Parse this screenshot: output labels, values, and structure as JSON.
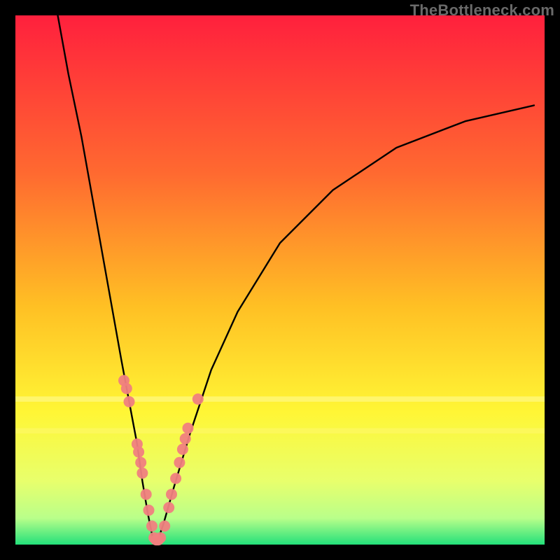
{
  "watermark": "TheBottleneck.com",
  "frame": {
    "outer_border_color": "#000000",
    "outer_border_px": 22,
    "inner_width": 756,
    "inner_height": 756
  },
  "gradient": {
    "stops": [
      {
        "offset": 0.0,
        "color": "#ff203d"
      },
      {
        "offset": 0.3,
        "color": "#ff6a30"
      },
      {
        "offset": 0.55,
        "color": "#ffc024"
      },
      {
        "offset": 0.75,
        "color": "#fff635"
      },
      {
        "offset": 0.88,
        "color": "#e8ff6c"
      },
      {
        "offset": 0.95,
        "color": "#b9ff8a"
      },
      {
        "offset": 1.0,
        "color": "#23e07a"
      }
    ],
    "notch_bands": [
      {
        "y": 0.72,
        "h": 0.01,
        "color": "#fffb9a"
      },
      {
        "y": 0.78,
        "h": 0.01,
        "color": "#fff86d"
      }
    ]
  },
  "chart_data": {
    "type": "line",
    "title": "",
    "xlabel": "",
    "ylabel": "",
    "xlim": [
      0,
      100
    ],
    "ylim": [
      0,
      100
    ],
    "series": [
      {
        "name": "bottleneck-curve",
        "color": "#000000",
        "x": [
          8,
          10,
          12.5,
          15,
          17.5,
          20,
          21.5,
          23,
          24,
          25,
          26,
          27,
          28,
          30,
          33,
          37,
          42,
          50,
          60,
          72,
          85,
          98
        ],
        "y": [
          100,
          89,
          77,
          63,
          49,
          35,
          27,
          19,
          12,
          6,
          1,
          1,
          4,
          11,
          21,
          33,
          44,
          57,
          67,
          75,
          80,
          83
        ]
      }
    ],
    "points": {
      "name": "sample-markers",
      "color": "#f08080",
      "radius": 8,
      "xy": [
        [
          20.5,
          31
        ],
        [
          21.0,
          29.5
        ],
        [
          21.5,
          27
        ],
        [
          23.0,
          19
        ],
        [
          23.3,
          17.5
        ],
        [
          23.7,
          15.5
        ],
        [
          24.0,
          13.5
        ],
        [
          24.7,
          9.5
        ],
        [
          25.2,
          6.5
        ],
        [
          25.8,
          3.5
        ],
        [
          26.2,
          1.3
        ],
        [
          26.6,
          0.9
        ],
        [
          27.0,
          0.9
        ],
        [
          27.4,
          1.3
        ],
        [
          28.2,
          3.5
        ],
        [
          29.0,
          7.0
        ],
        [
          29.5,
          9.5
        ],
        [
          30.3,
          12.5
        ],
        [
          31.0,
          15.5
        ],
        [
          31.6,
          18.0
        ],
        [
          32.1,
          20.0
        ],
        [
          32.6,
          22.0
        ],
        [
          34.5,
          27.5
        ]
      ]
    }
  }
}
